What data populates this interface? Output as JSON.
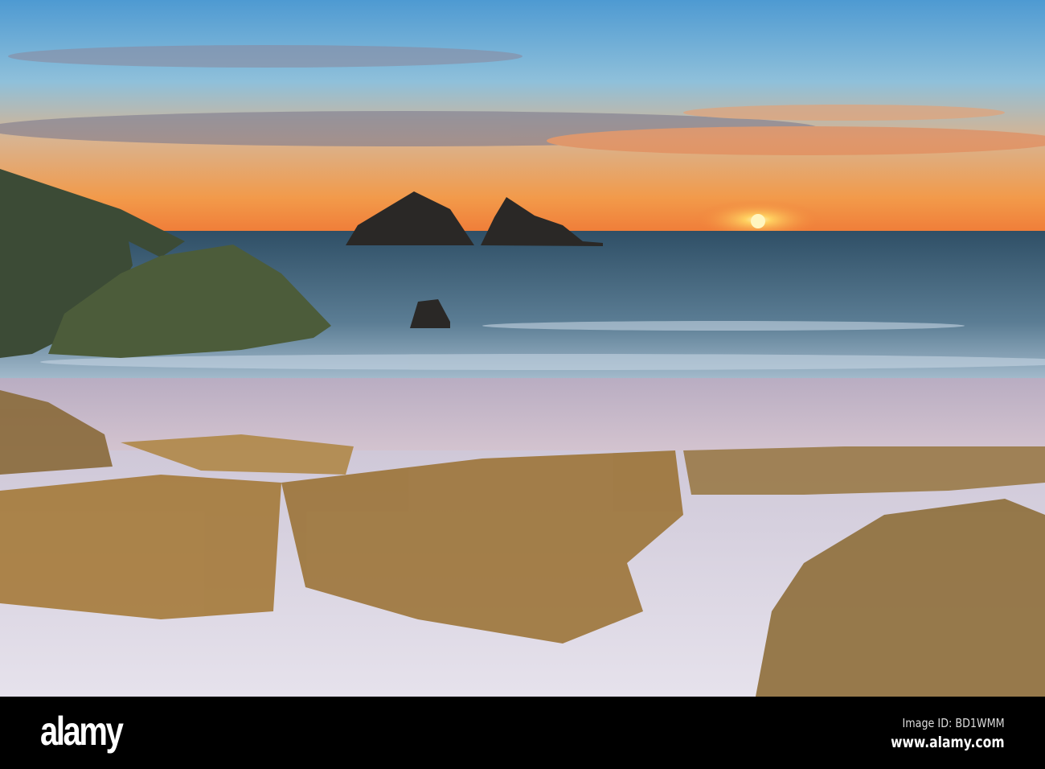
{
  "photo": {
    "subject": "sunset-beach",
    "colors": {
      "sky_top": "#4e9ad2",
      "sky_horizon": "#f29a4a",
      "sun": "#fff6c0",
      "sea": "#3e5a70",
      "sand": "#d8cfdc",
      "grass": "#a57a3a"
    }
  },
  "footer": {
    "logo": "alamy",
    "image_id": "Image ID: BD1WMM",
    "url": "www.alamy.com"
  }
}
